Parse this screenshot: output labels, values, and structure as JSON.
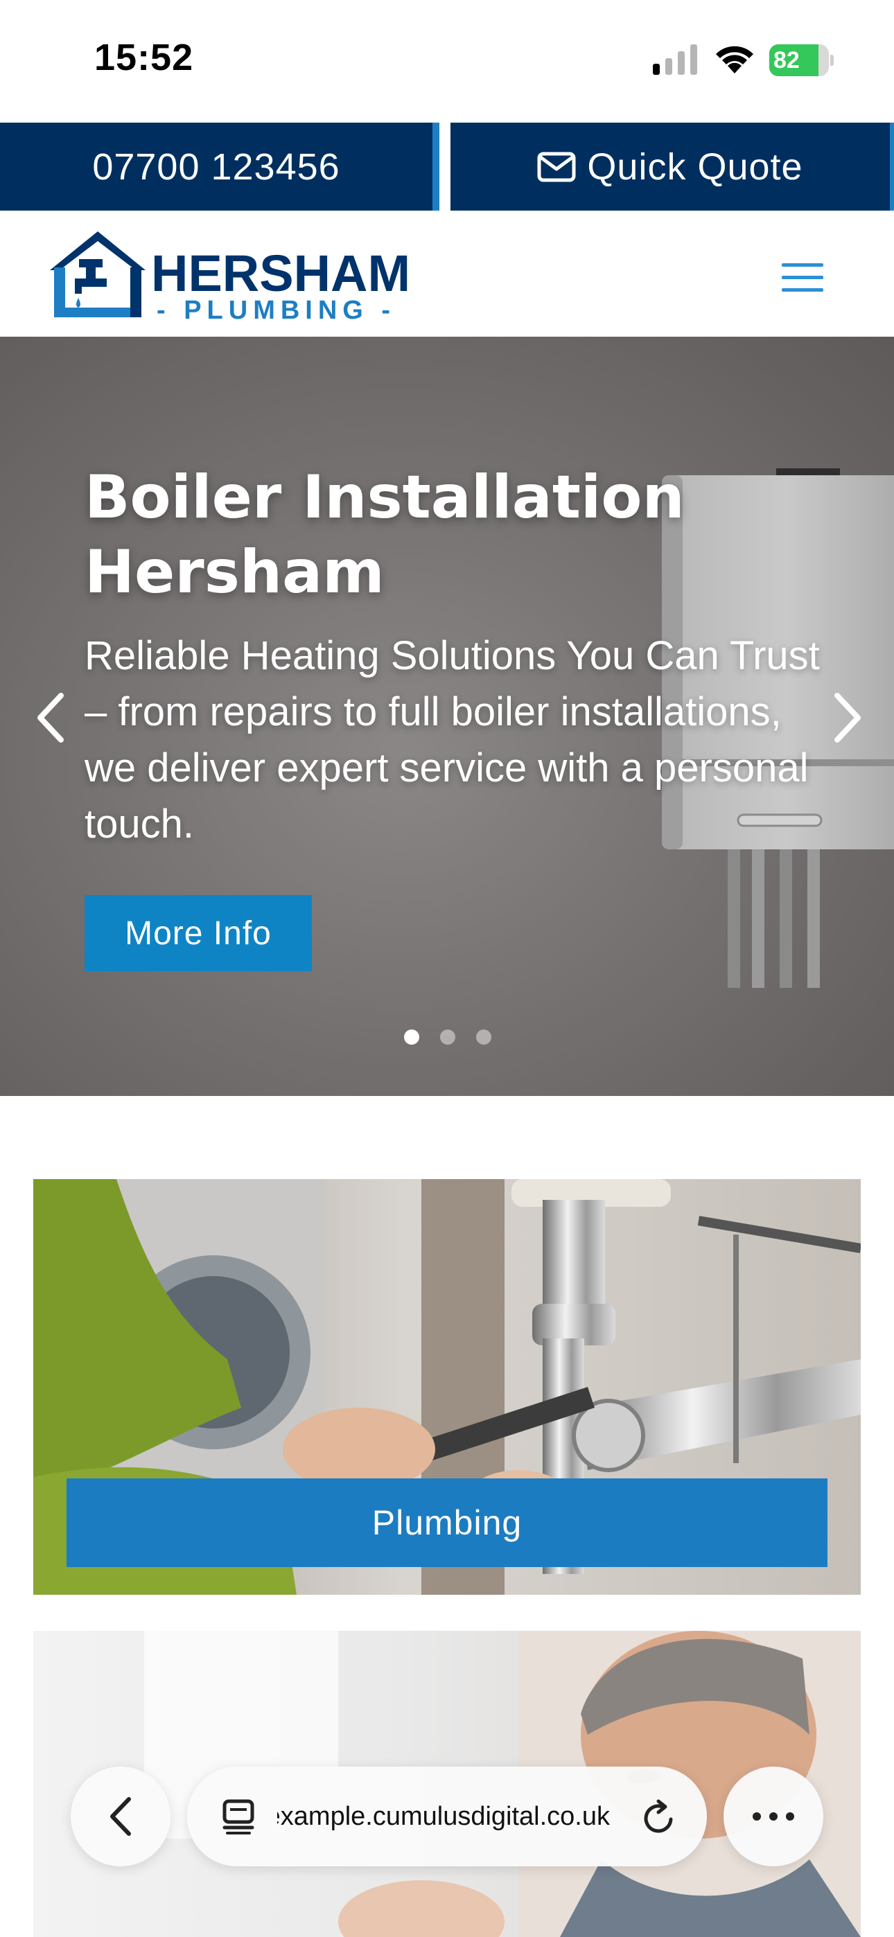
{
  "status_bar": {
    "time": "15:52",
    "battery_level": "82",
    "battery_fraction": 0.82,
    "icons": [
      "cellular-signal-icon",
      "wifi-icon",
      "battery-charging-icon"
    ]
  },
  "top_bar": {
    "phone": "07700 123456",
    "quote_label": "Quick Quote",
    "quote_icon": "envelope-icon",
    "colors": {
      "background": "#002f5f",
      "divider": "#1d7ec4"
    }
  },
  "header": {
    "logo_main": "HERSHAM",
    "logo_sub": "- PLUMBING -",
    "menu_icon": "hamburger-menu-icon",
    "colors": {
      "logo_navy": "#00336b",
      "logo_blue": "#1d7ec4"
    }
  },
  "hero": {
    "title": "Boiler Installation Hersham",
    "text": "Reliable Heating Solutions You Can Trust – from repairs to full boiler installations, we deliver expert service with a personal touch.",
    "button_label": "More Info",
    "slide_count": 3,
    "active_slide": 1,
    "colors": {
      "button": "#0f84c5"
    }
  },
  "services": [
    {
      "label": "Plumbing"
    },
    {
      "label": ""
    }
  ],
  "browser": {
    "url": "example.cumulusdigital.co.uk",
    "icons": [
      "back-icon",
      "tabs-icon",
      "reload-icon",
      "more-icon"
    ]
  }
}
